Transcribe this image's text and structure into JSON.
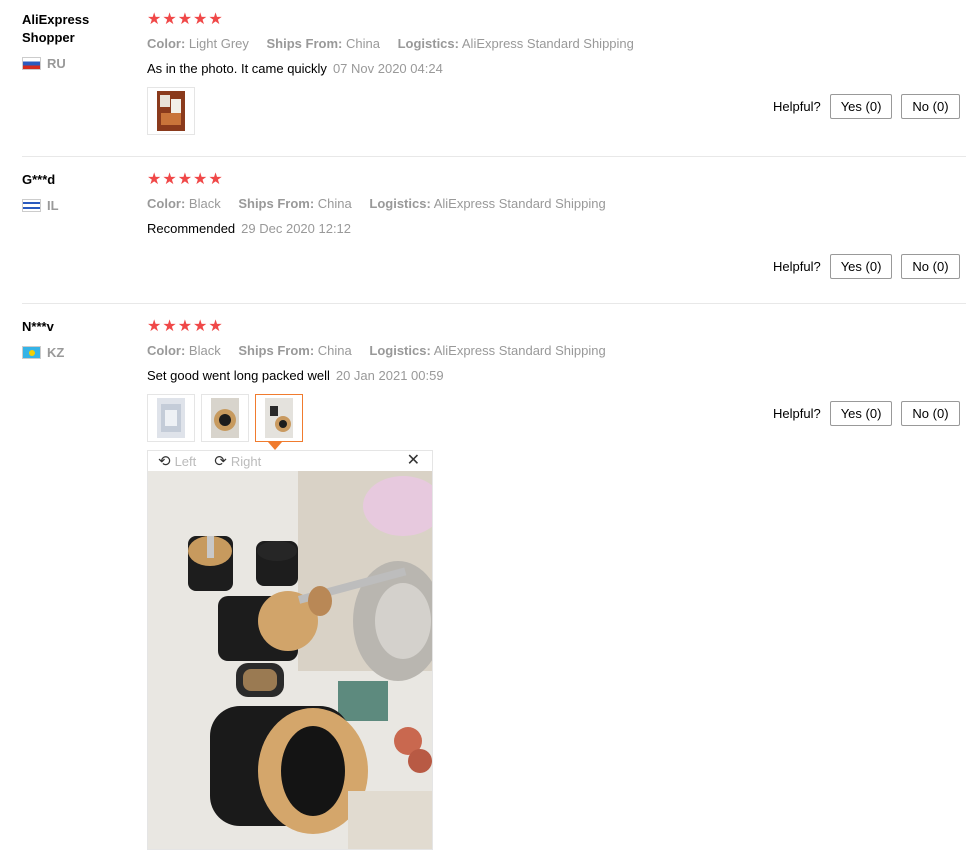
{
  "reviews": [
    {
      "name": "AliExpress Shopper",
      "country": "RU",
      "stars": "★★★★★",
      "color_label": "Color:",
      "color_value": "Light Grey",
      "ships_label": "Ships From:",
      "ships_value": "China",
      "logistics_label": "Logistics:",
      "logistics_value": "AliExpress Standard Shipping",
      "text": "As in the photo. It came quickly",
      "date": "07 Nov 2020 04:24"
    },
    {
      "name": "G***d",
      "country": "IL",
      "stars": "★★★★★",
      "color_label": "Color:",
      "color_value": "Black",
      "ships_label": "Ships From:",
      "ships_value": "China",
      "logistics_label": "Logistics:",
      "logistics_value": "AliExpress Standard Shipping",
      "text": "Recommended",
      "date": "29 Dec 2020 12:12"
    },
    {
      "name": "N***v",
      "country": "KZ",
      "stars": "★★★★★",
      "color_label": "Color:",
      "color_value": "Black",
      "ships_label": "Ships From:",
      "ships_value": "China",
      "logistics_label": "Logistics:",
      "logistics_value": "AliExpress Standard Shipping",
      "text": "Set good went long packed well",
      "date": "20 Jan 2021 00:59"
    }
  ],
  "helpful": {
    "label": "Helpful?",
    "yes": "Yes (0)",
    "no": "No (0)"
  },
  "viewer": {
    "left_label": "Left",
    "right_label": "Right",
    "close": "✕",
    "rotate_left_icon": "⟲",
    "rotate_right_icon": "⟳"
  },
  "colors": {
    "star": "#f04848",
    "accent": "#f07b2e",
    "muted": "#999999"
  }
}
